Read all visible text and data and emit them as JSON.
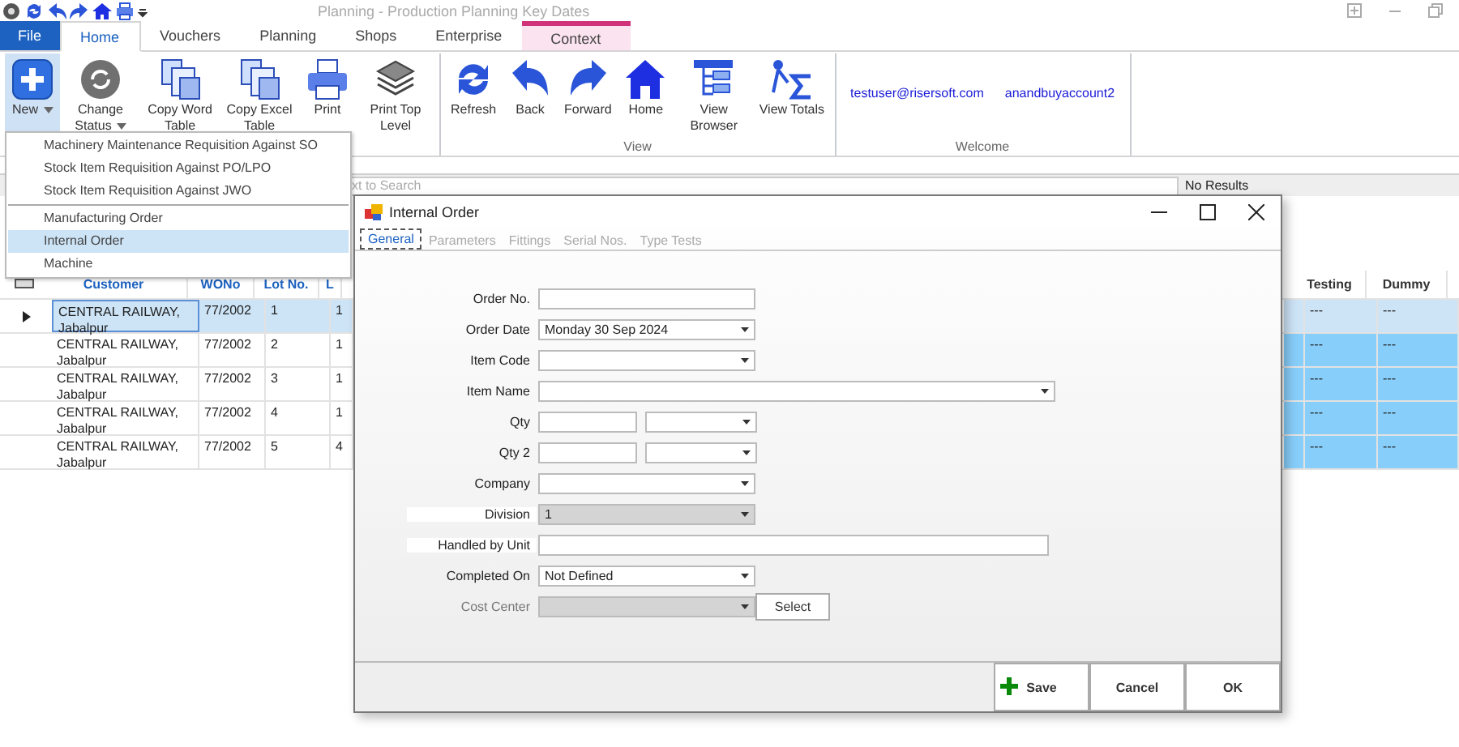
{
  "window": {
    "title": "Planning - Production Planning Key Dates"
  },
  "ribbon_tabs": [
    {
      "label": "File",
      "kind": "file",
      "selected": false
    },
    {
      "label": "Home",
      "kind": "tab",
      "selected": true
    },
    {
      "label": "Vouchers",
      "kind": "tab",
      "selected": false
    },
    {
      "label": "Planning",
      "kind": "tab",
      "selected": false
    },
    {
      "label": "Shops",
      "kind": "tab",
      "selected": false
    },
    {
      "label": "Enterprise",
      "kind": "tab",
      "selected": false
    },
    {
      "label": "Context",
      "kind": "context",
      "selected": false
    }
  ],
  "ribbon_groups": [
    {
      "buttons": [
        {
          "label": "New",
          "dropdown": true,
          "selected": true
        },
        {
          "label": "Change Status",
          "dropdown": true,
          "selected": false
        },
        {
          "label": "Copy Word Table",
          "dropdown": false,
          "selected": false
        },
        {
          "label": "Copy Excel Table",
          "dropdown": false,
          "selected": false
        },
        {
          "label": "Print",
          "dropdown": false,
          "selected": false
        },
        {
          "label": "Print Top Level",
          "dropdown": false,
          "selected": false
        }
      ]
    },
    {
      "label": "View",
      "buttons": [
        {
          "label": "Refresh",
          "dropdown": false,
          "selected": false
        },
        {
          "label": "Back",
          "dropdown": false,
          "selected": false
        },
        {
          "label": "Forward",
          "dropdown": false,
          "selected": false
        },
        {
          "label": "Home",
          "dropdown": false,
          "selected": false
        },
        {
          "label": "View Browser",
          "dropdown": false,
          "selected": false
        },
        {
          "label": "View Totals",
          "dropdown": false,
          "selected": false
        }
      ]
    },
    {
      "label": "Welcome",
      "links": [
        "testuser@risersoft.com",
        "anandbuyaccount2"
      ]
    }
  ],
  "search": {
    "placeholder": "xt to Search",
    "result": "No Results"
  },
  "new_menu": [
    {
      "label": "Machinery Maintenance Requisition Against SO",
      "separator_before": false,
      "selected": false
    },
    {
      "label": "Stock Item Requisition Against PO/LPO",
      "separator_before": false,
      "selected": false
    },
    {
      "label": "Stock Item Requisition Against JWO",
      "separator_before": false,
      "selected": false
    },
    {
      "label": "Manufacturing Order",
      "separator_before": true,
      "selected": false
    },
    {
      "label": "Internal Order",
      "separator_before": false,
      "selected": true
    },
    {
      "label": "Machine",
      "separator_before": false,
      "selected": false
    }
  ],
  "grid": {
    "columns": [
      "Customer",
      "WONo",
      "Lot No.",
      "L",
      "Testing",
      "Dummy"
    ],
    "rows": [
      {
        "selected": true,
        "cells": [
          "CENTRAL RAILWAY, Jabalpur",
          "77/2002",
          "1",
          "1",
          "---",
          "---"
        ]
      },
      {
        "selected": false,
        "cells": [
          "CENTRAL RAILWAY, Jabalpur",
          "77/2002",
          "2",
          "1",
          "---",
          "---"
        ]
      },
      {
        "selected": false,
        "cells": [
          "CENTRAL RAILWAY, Jabalpur",
          "77/2002",
          "3",
          "1",
          "---",
          "---"
        ]
      },
      {
        "selected": false,
        "cells": [
          "CENTRAL RAILWAY, Jabalpur",
          "77/2002",
          "4",
          "1",
          "---",
          "---"
        ]
      },
      {
        "selected": false,
        "cells": [
          "CENTRAL RAILWAY, Jabalpur",
          "77/2002",
          "5",
          "4",
          "---",
          "---"
        ]
      }
    ]
  },
  "dialog": {
    "title": "Internal Order",
    "tabs": [
      {
        "label": "General",
        "selected": true
      },
      {
        "label": "Parameters",
        "selected": false
      },
      {
        "label": "Fittings",
        "selected": false
      },
      {
        "label": "Serial Nos.",
        "selected": false
      },
      {
        "label": "Type Tests",
        "selected": false
      }
    ],
    "fields": [
      {
        "label": "Order No.",
        "kind": "text",
        "disabled": false
      },
      {
        "label": "Order Date",
        "kind": "combo",
        "value": "Monday 30 Sep 2024",
        "disabled": false
      },
      {
        "label": "Item Code",
        "kind": "combo",
        "disabled": false
      },
      {
        "label": "Item Name",
        "kind": "wide-combo",
        "disabled": false
      },
      {
        "label": "Qty",
        "kind": "pair",
        "disabled": false
      },
      {
        "label": "Qty 2",
        "kind": "pair",
        "disabled": false
      },
      {
        "label": "Company",
        "kind": "combo",
        "disabled": false
      },
      {
        "label": "Division",
        "kind": "combo",
        "value": "1",
        "disabled": true
      },
      {
        "label": "Handled by Unit",
        "kind": "wide-text",
        "disabled": false
      },
      {
        "label": "Completed On",
        "kind": "combo",
        "value": "Not Defined",
        "disabled": false
      },
      {
        "label": "Cost Center",
        "kind": "combo-button",
        "button": "Select",
        "disabled": true
      }
    ],
    "buttons": [
      {
        "label": "Save",
        "kind": "save"
      },
      {
        "label": "Cancel",
        "kind": "plain"
      },
      {
        "label": "OK",
        "kind": "plain"
      }
    ]
  }
}
